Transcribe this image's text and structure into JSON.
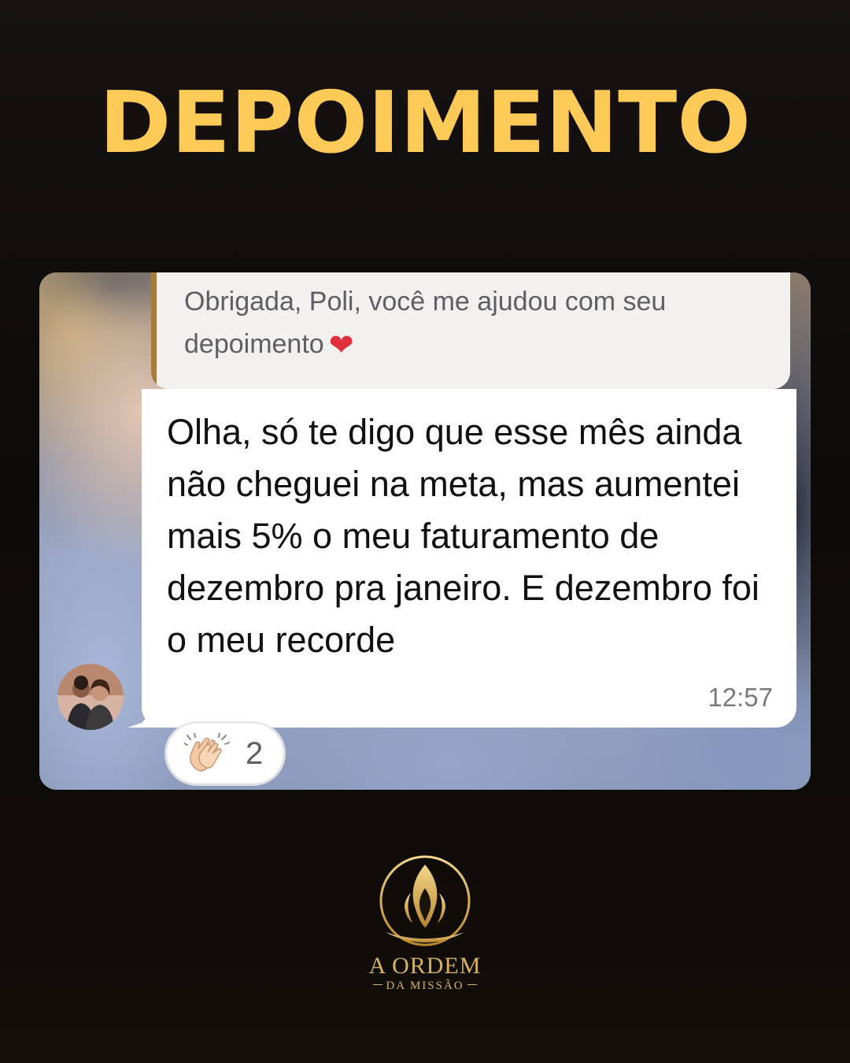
{
  "headline": "DEPOIMENTO",
  "chat": {
    "quoted_message": {
      "text": "Obrigada, Poli, você me ajudou com seu depoimento",
      "emoji": "❤"
    },
    "message": {
      "text": "Olha, só te digo que esse mês ainda não cheguei na meta, mas aumentei mais 5% o meu faturamento de dezembro pra janeiro. E dezembro foi o meu recorde",
      "time": "12:57"
    },
    "reaction": {
      "icon": "clapping-hands-icon",
      "count": "2"
    },
    "avatar": "avatar"
  },
  "brand": {
    "name": "A ORDEM",
    "tagline": "DA MISSÃO",
    "logo": "flame-emblem-icon"
  },
  "colors": {
    "headline": "#fdca57",
    "gold": "#d8b25e",
    "quote_bar": "#a67c3d",
    "background": "#0d0b09"
  }
}
